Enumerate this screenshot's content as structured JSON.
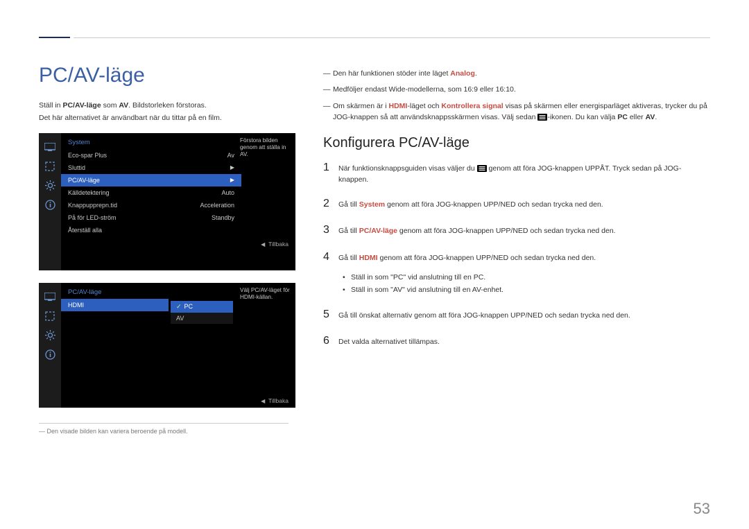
{
  "page": {
    "title": "PC/AV-läge",
    "number": "53"
  },
  "intro": {
    "line1_pre": "Ställ in ",
    "line1_bold": "PC/AV-läge",
    "line1_mid": " som ",
    "line1_bold2": "AV",
    "line1_post": ". Bildstorleken förstoras.",
    "line2": "Det här alternativet är användbart när du tittar på en film."
  },
  "osd1": {
    "header": "System",
    "desc": "Förstora bilden genom att ställa in AV.",
    "items": [
      {
        "label": "Eco-spar Plus",
        "value": "Av"
      },
      {
        "label": "Sluttid",
        "value": "▶"
      },
      {
        "label": "PC/AV-läge",
        "value": "▶",
        "selected": true
      },
      {
        "label": "Källdetektering",
        "value": "Auto"
      },
      {
        "label": "Knappupprepn.tid",
        "value": "Acceleration"
      },
      {
        "label": "På för LED-ström",
        "value": "Standby"
      },
      {
        "label": "Återställ alla",
        "value": ""
      }
    ],
    "footer": "Tillbaka"
  },
  "osd2": {
    "header": "PC/AV-läge",
    "desc": "Välj PC/AV-läget för HDMI-källan.",
    "items": [
      {
        "label": "HDMI",
        "selected": true
      }
    ],
    "sub": [
      {
        "label": "PC",
        "selected": true,
        "check": true
      },
      {
        "label": "AV"
      }
    ],
    "footer": "Tillbaka"
  },
  "footnote": "Den visade bilden kan variera beroende på modell.",
  "notes": {
    "n1_pre": "Den här funktionen stöder inte läget ",
    "n1_red": "Analog",
    "n1_post": ".",
    "n2": "Medföljer endast Wide-modellerna, som 16:9 eller 16:10.",
    "n3_a": "Om skärmen är i ",
    "n3_b": "HDMI",
    "n3_c": "-läget och ",
    "n3_d": "Kontrollera signal",
    "n3_e": " visas på skärmen eller energisparläget aktiveras, trycker du på JOG-knappen så att användsknappsskärmen visas. Välj sedan ",
    "n3_f": "-ikonen. Du kan välja ",
    "n3_g": "PC",
    "n3_h": " eller ",
    "n3_i": "AV",
    "n3_j": "."
  },
  "subheading": "Konfigurera PC/AV-läge",
  "steps": {
    "s1_a": "När funktionsknappsguiden visas väljer du ",
    "s1_b": " genom att föra JOG-knappen UPPÅT. Tryck sedan på JOG-knappen.",
    "s2_a": "Gå till ",
    "s2_red": "System",
    "s2_b": " genom att föra JOG-knappen UPP/NED och sedan trycka ned den.",
    "s3_a": "Gå till ",
    "s3_red": "PC/AV-läge",
    "s3_b": " genom att föra JOG-knappen UPP/NED och sedan trycka ned den.",
    "s4_a": "Gå till ",
    "s4_red": "HDMI",
    "s4_b": " genom att föra JOG-knappen UPP/NED och sedan trycka ned den.",
    "b1": "Ställ in som \"PC\" vid anslutning till en PC.",
    "b2": "Ställ in som \"AV\" vid anslutning till en AV-enhet.",
    "s5": "Gå till önskat alternativ genom att föra JOG-knappen UPP/NED och sedan trycka ned den.",
    "s6": "Det valda alternativet tillämpas."
  }
}
